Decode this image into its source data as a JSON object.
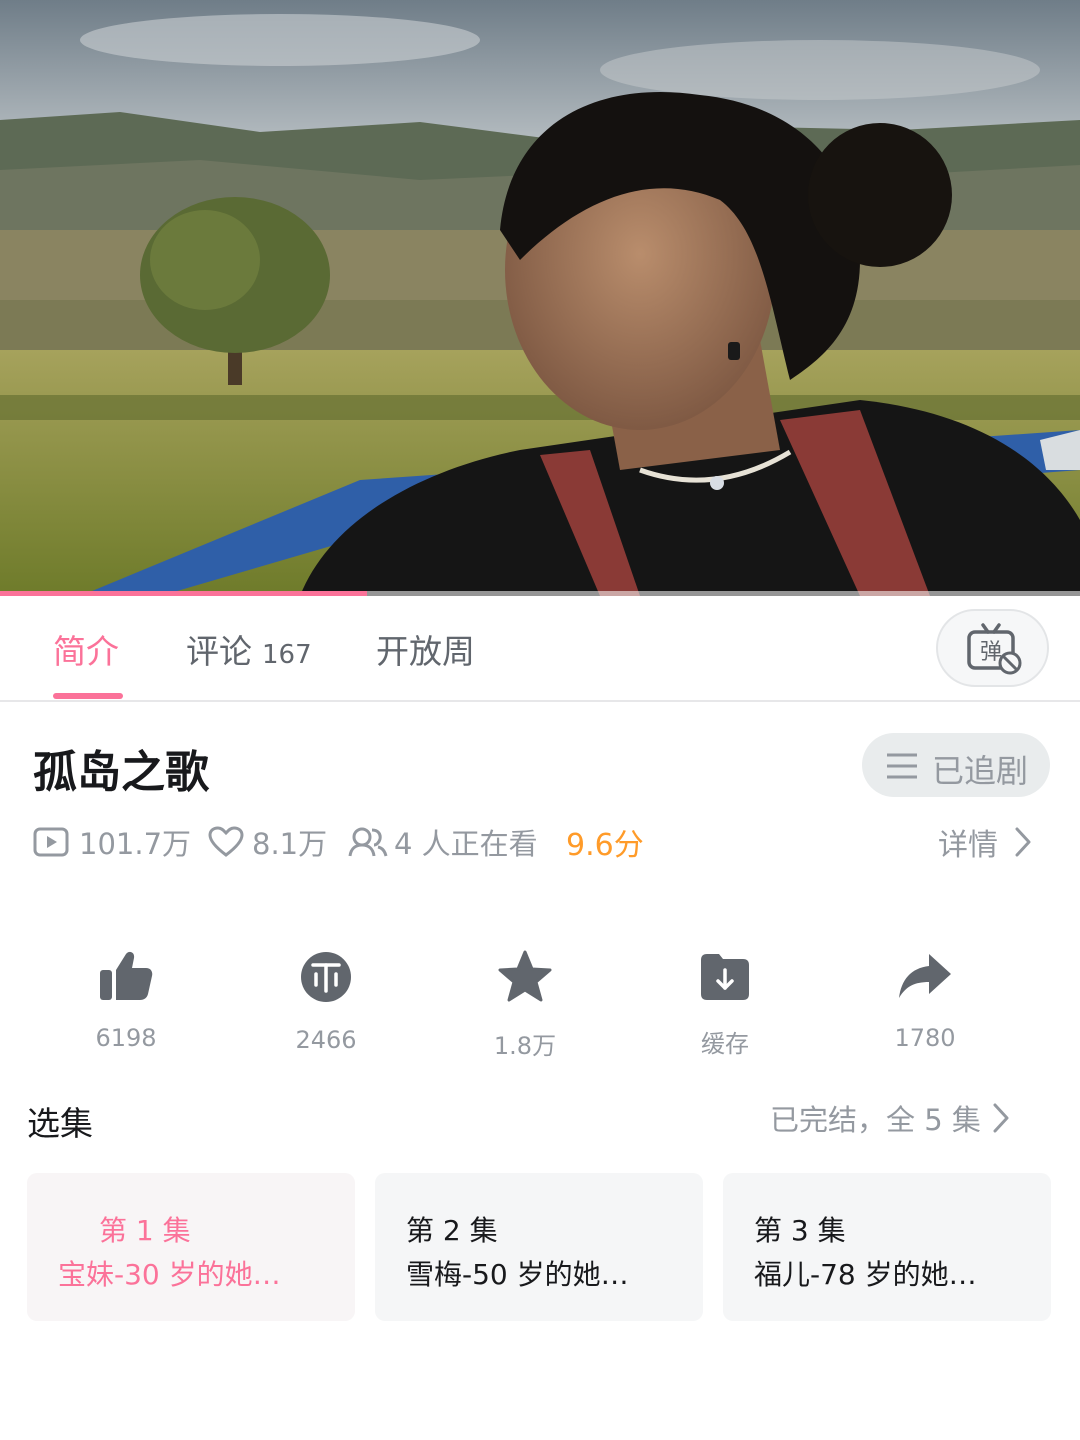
{
  "video": {
    "progress_percent": 34
  },
  "tabs": [
    {
      "label": "简介",
      "count": "",
      "active": true
    },
    {
      "label": "评论",
      "count": "167",
      "active": false
    },
    {
      "label": "开放周",
      "count": "",
      "active": false
    }
  ],
  "danmaku_toggle": {
    "icon": "danmaku-off-icon",
    "glyph": "弹"
  },
  "title": "孤岛之歌",
  "follow_button": {
    "label": "已追剧",
    "icon": "menu-icon"
  },
  "meta": {
    "plays": "101.7万",
    "likes": "8.1万",
    "watching": "4 人正在看",
    "score": "9.6分",
    "details_label": "详情"
  },
  "actions": [
    {
      "icon": "thumb-up-icon",
      "value": "6198"
    },
    {
      "icon": "coin-icon",
      "value": "2466"
    },
    {
      "icon": "star-icon",
      "value": "1.8万"
    },
    {
      "icon": "download-icon",
      "value": "缓存"
    },
    {
      "icon": "share-icon",
      "value": "1780"
    }
  ],
  "episodes_section": {
    "title": "选集",
    "status": "已完结，全 5 集"
  },
  "episodes": [
    {
      "number": "第 1 集",
      "title": "宝妹-30 岁的她…",
      "active": true
    },
    {
      "number": "第 2 集",
      "title": "雪梅-50 岁的她…",
      "active": false
    },
    {
      "number": "第 3 集",
      "title": "福儿-78 岁的她…",
      "active": false
    }
  ],
  "colors": {
    "accent": "#fb7299",
    "score": "#ff9b29",
    "muted": "#9499a0",
    "icon": "#61666d"
  }
}
